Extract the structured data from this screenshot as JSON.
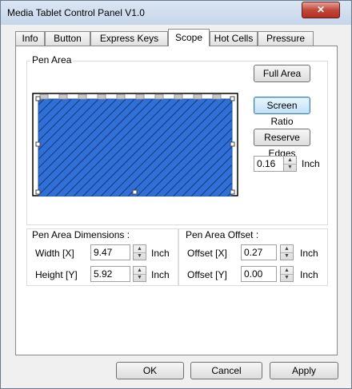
{
  "window": {
    "title": "Media Tablet Control Panel V1.0",
    "close_glyph": "✕"
  },
  "tabs": [
    {
      "label": "Info",
      "active": false
    },
    {
      "label": "Button",
      "active": false
    },
    {
      "label": "Express Keys",
      "active": false
    },
    {
      "label": "Scope",
      "active": true
    },
    {
      "label": "Hot Cells",
      "active": false
    },
    {
      "label": "Pressure",
      "active": false
    }
  ],
  "pen_area": {
    "group_label": "Pen Area",
    "full_area_label": "Full Area",
    "screen_ratio_label": "Screen Ratio",
    "reserve_edges_label": "Reserve Edges",
    "reserve_value": "0.16",
    "reserve_unit": "Inch",
    "area_fill_color": "#2f6fd6"
  },
  "dimensions": {
    "group_label": "Pen Area Dimensions :",
    "width_label": "Width [X]",
    "width_value": "9.47",
    "height_label": "Height [Y]",
    "height_value": "5.92",
    "unit": "Inch"
  },
  "offset": {
    "group_label": "Pen Area Offset :",
    "x_label": "Offset [X]",
    "x_value": "0.27",
    "y_label": "Offset [Y]",
    "y_value": "0.00",
    "unit": "Inch"
  },
  "footer": {
    "ok_label": "OK",
    "cancel_label": "Cancel",
    "apply_label": "Apply"
  }
}
